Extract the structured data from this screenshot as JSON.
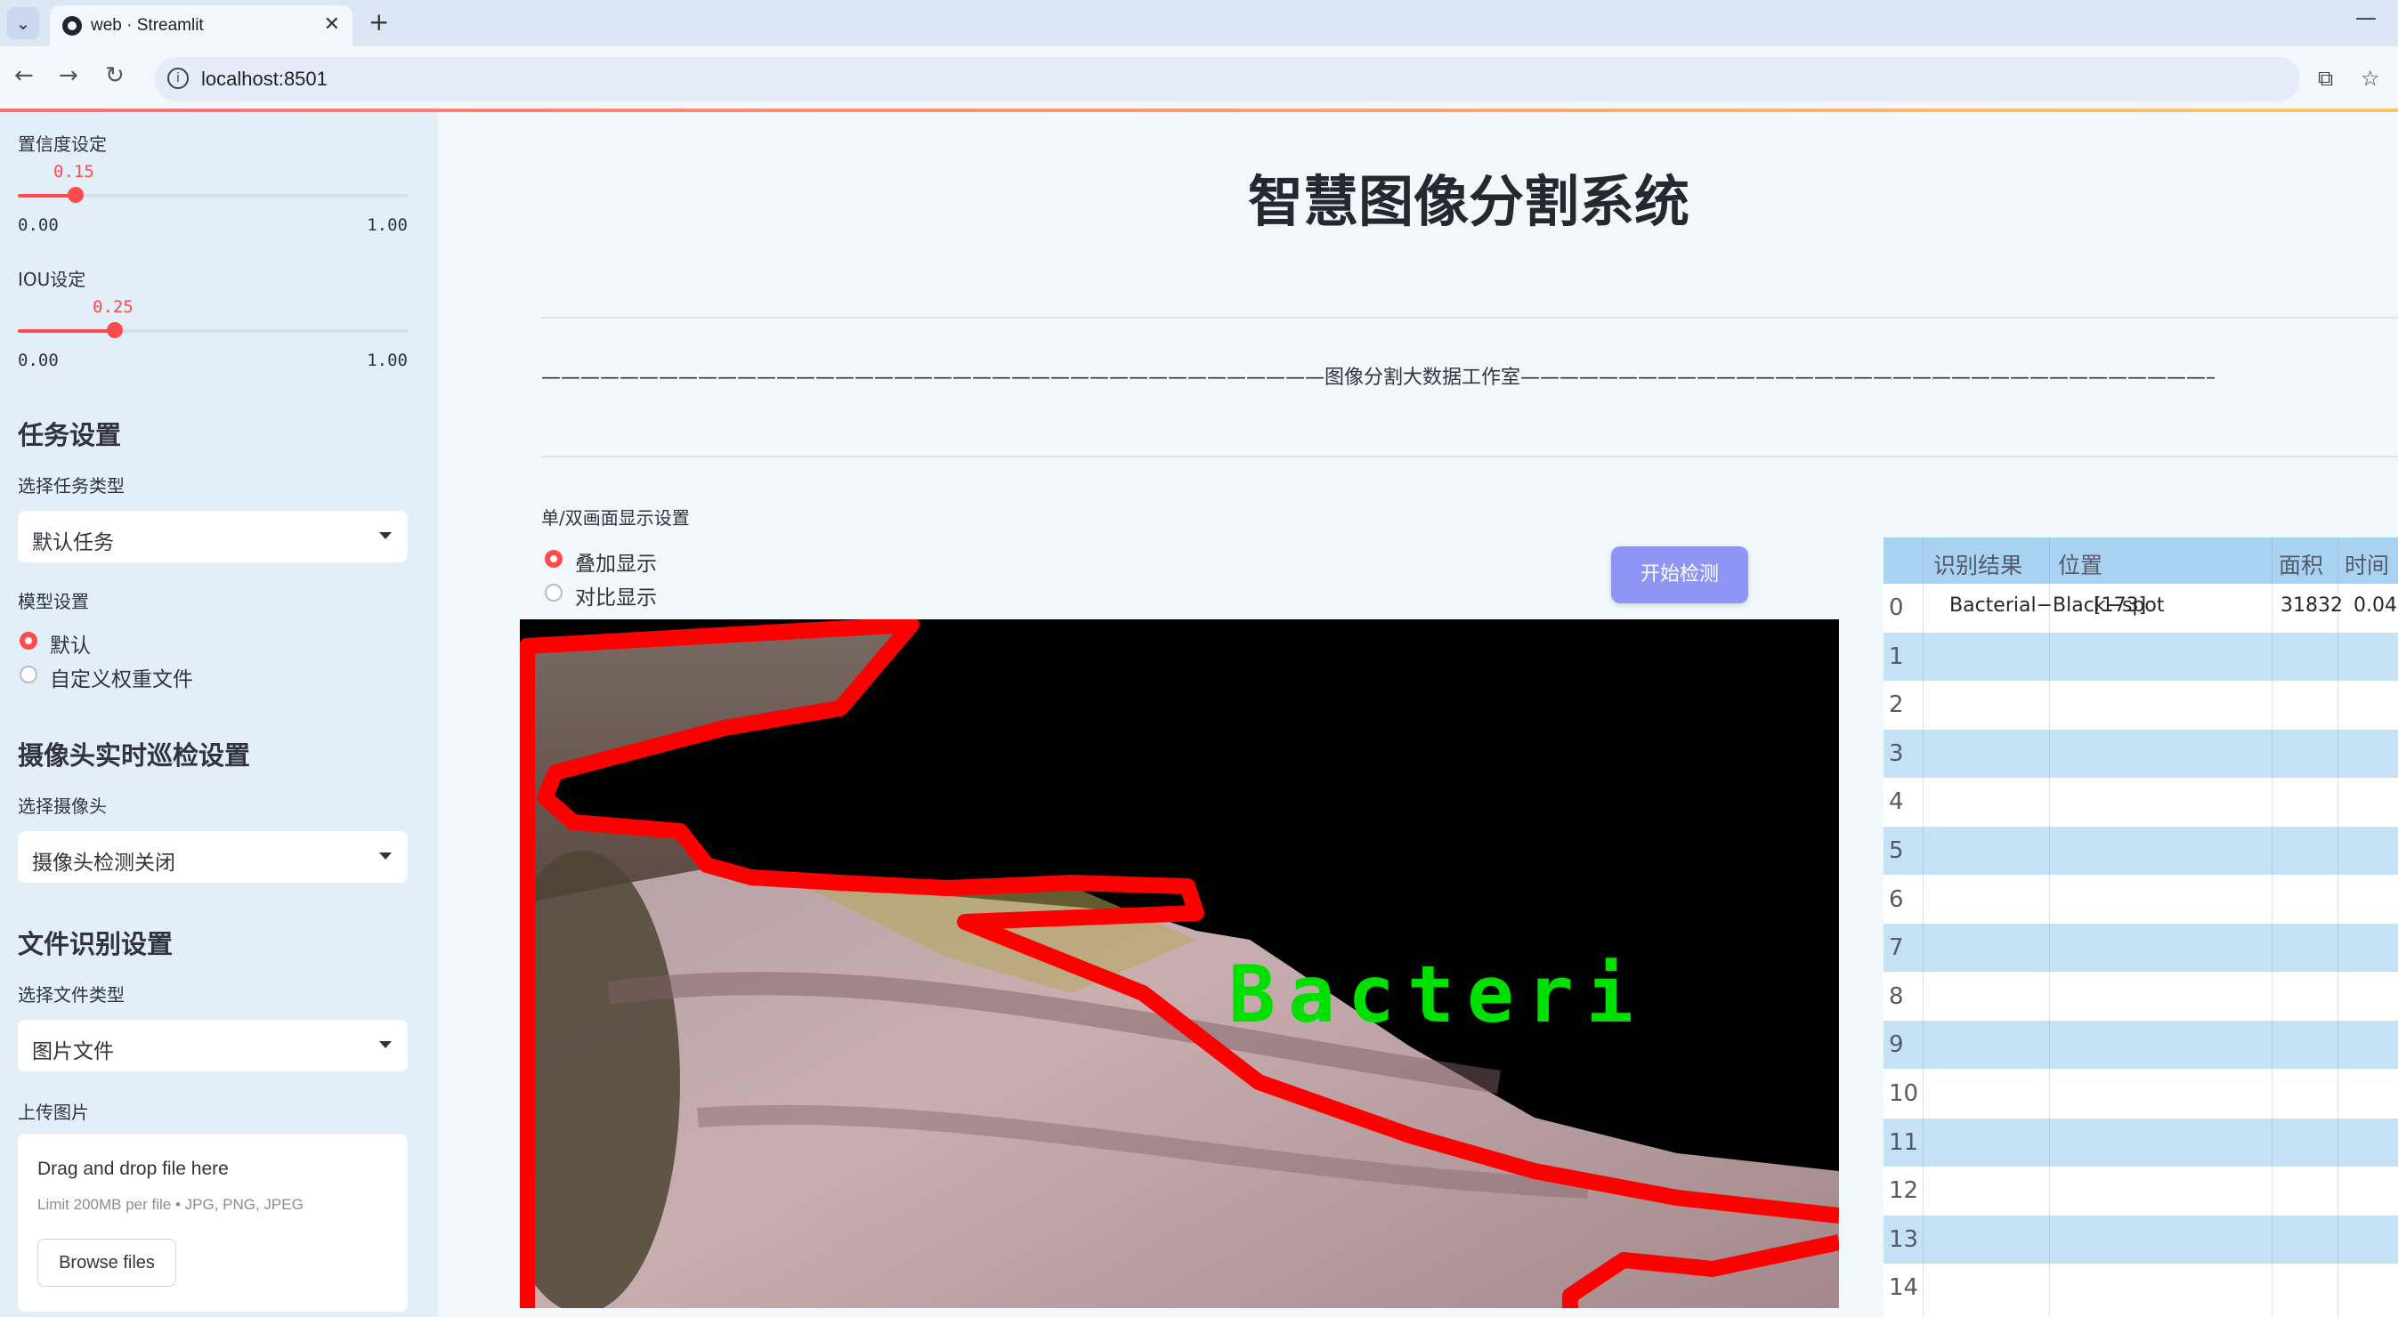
{
  "browser": {
    "tab_title": "web · Streamlit",
    "new_tab": "+",
    "close": "✕",
    "url": "localhost:8501",
    "minimize": "—"
  },
  "sidebar": {
    "confidence_label": "置信度设定",
    "confidence": {
      "value": "0.15",
      "min": "0.00",
      "max": "1.00",
      "level": 0.15
    },
    "iou_label": "IOU设定",
    "iou": {
      "value": "0.25",
      "min": "0.00",
      "max": "1.00",
      "level": 0.25
    },
    "task_heading": "任务设置",
    "task_type_label": "选择任务类型",
    "task_type_value": "默认任务",
    "model_label": "模型设置",
    "model_options": [
      "默认",
      "自定义权重文件"
    ],
    "camera_heading": "摄像头实时巡检设置",
    "camera_label": "选择摄像头",
    "camera_value": "摄像头检测关闭",
    "file_heading": "文件识别设置",
    "file_type_label": "选择文件类型",
    "file_type_value": "图片文件",
    "upload_label": "上传图片",
    "upload_drop": "Drag and drop file here",
    "upload_limit": "Limit 200MB per file • JPG, PNG, JPEG",
    "upload_button": "Browse files"
  },
  "main": {
    "title": "智慧图像分割系统",
    "subtitle_line": "————————————————————————————————————————图像分割大数据工作室————————————————————————————————————————",
    "display_label": "单/双画面显示设置",
    "display_options": [
      "叠加显示",
      "对比显示"
    ],
    "detect_button": "开始检测",
    "overlay_text": "Bacteri"
  },
  "table": {
    "columns": [
      "识别结果",
      "位置",
      "面积",
      "时间"
    ],
    "rows": [
      {
        "index": "0",
        "result": "Bacterial−Black−spot",
        "position": "[173]",
        "area": "31832",
        "time": "0.04"
      },
      {
        "index": "1"
      },
      {
        "index": "2"
      },
      {
        "index": "3"
      },
      {
        "index": "4"
      },
      {
        "index": "5"
      },
      {
        "index": "6"
      },
      {
        "index": "7"
      },
      {
        "index": "8"
      },
      {
        "index": "9"
      },
      {
        "index": "10"
      },
      {
        "index": "11"
      },
      {
        "index": "12"
      },
      {
        "index": "13"
      },
      {
        "index": "14"
      }
    ]
  },
  "colors": {
    "accent": "#ff4b4b",
    "button": "#8e95f5",
    "table_header": "#a8d2f2",
    "table_alt": "#c5e1f6",
    "mask_outline": "#ff0000",
    "label_text": "#00ff00"
  }
}
